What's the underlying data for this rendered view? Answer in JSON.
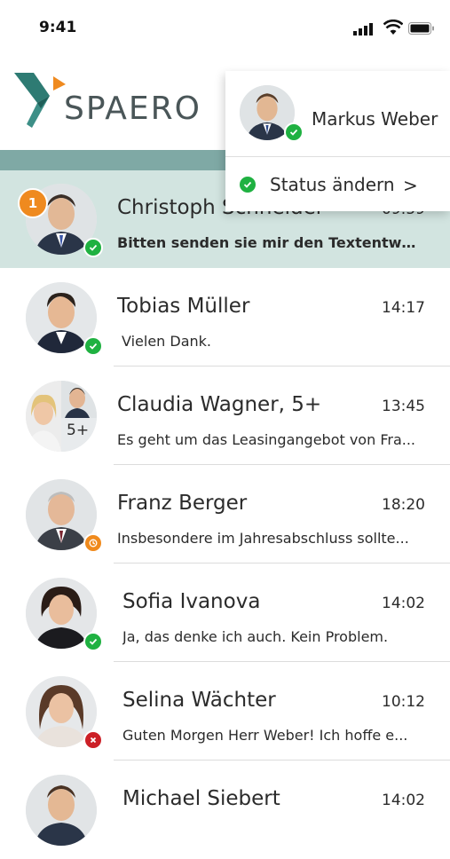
{
  "status_bar": {
    "time": "9:41"
  },
  "brand": {
    "name": "SPAERO",
    "colors": {
      "teal": "#2e7b73",
      "orange": "#ef8a1f",
      "accent_bar": "#7fa9a5"
    }
  },
  "user_menu": {
    "name": "Markus Weber",
    "presence": "available",
    "status_action": "Status ändern",
    "status_chevron": ">"
  },
  "conversations": [
    {
      "name": "Christoph Schneider",
      "time": "09:59",
      "preview": "Bitten senden sie mir den Textentwurf...",
      "presence": "available",
      "unread": "1",
      "active": true
    },
    {
      "name": "Tobias Müller",
      "time": "14:17",
      "preview": "Vielen Dank.",
      "presence": "available"
    },
    {
      "name": "Claudia Wagner, 5+",
      "time": "13:45",
      "preview": "Es geht um das Leasingangebot von Fra...",
      "presence": "group",
      "group_count": "5+"
    },
    {
      "name": "Franz Berger",
      "time": "18:20",
      "preview": "Insbesondere im Jahresabschluss sollte...",
      "presence": "away"
    },
    {
      "name": "Sofia Ivanova",
      "time": "14:02",
      "preview": "Ja, das denke ich auch. Kein Problem.",
      "presence": "available"
    },
    {
      "name": "Selina Wächter",
      "time": "10:12",
      "preview": "Guten Morgen Herr Weber! Ich hoffe e...",
      "presence": "busy"
    },
    {
      "name": "Michael Siebert",
      "time": "14:02",
      "preview": "",
      "presence": "available"
    }
  ]
}
